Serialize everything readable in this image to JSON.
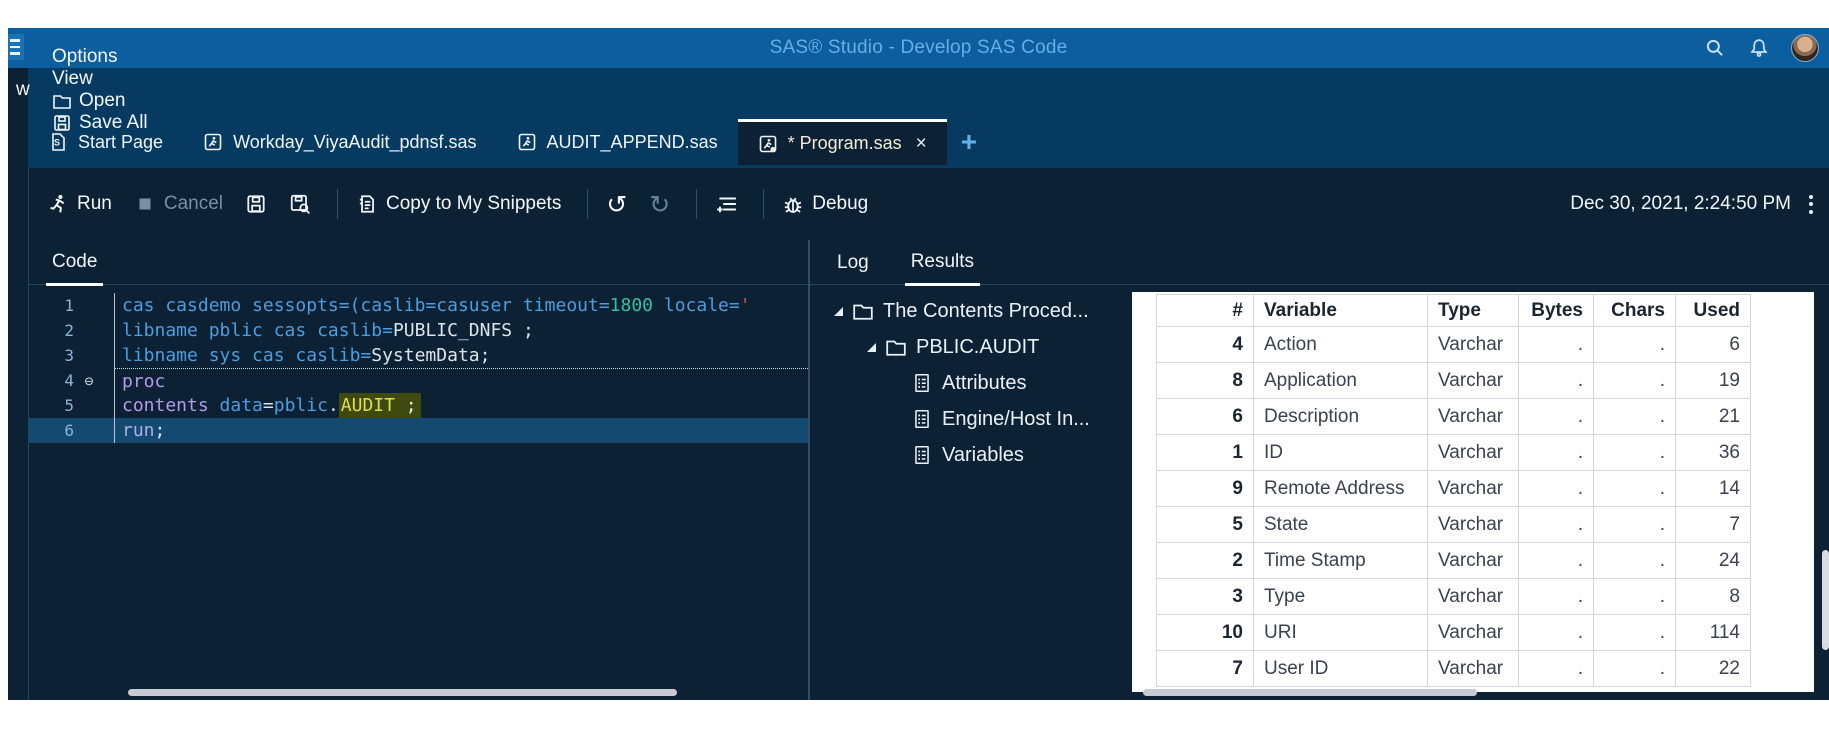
{
  "palette": {
    "title_bar_bg": "#0D5E9E",
    "title_text": "#66AEE6",
    "strip_bg": "#063A60",
    "content_bg": "#0C2134",
    "active_tab_border": "#FFFFFF",
    "selected_line_bg": "#154A70",
    "keyword_blue": "#4C9EE0",
    "number_teal": "#38BFA2",
    "proc_purple": "#B49AE8",
    "string_red": "#C05A50",
    "search_highlight_bg": "#3E4A0E",
    "search_highlight_text": "#E0DE54",
    "table_bg": "#FFFFFF",
    "add_tab_blue": "#5FB0EC"
  },
  "title_bar": {
    "title": "SAS® Studio - Develop SAS Code",
    "icons": [
      "hamburger-icon",
      "search-icon",
      "bell-icon",
      "avatar"
    ]
  },
  "menu_bar": {
    "partial_item": "w",
    "items": [
      {
        "label": "Options",
        "icon": null
      },
      {
        "label": "View",
        "icon": null
      },
      {
        "label": "Open",
        "icon": "folder-icon"
      },
      {
        "label": "Save All",
        "icon": "save-all-icon"
      }
    ]
  },
  "tab_strip": {
    "tabs": [
      {
        "label": "Start Page",
        "icon": "start-page-icon",
        "active": false,
        "close": null
      },
      {
        "label": "Workday_ViyaAudit_pdnsf.sas",
        "icon": "program-icon",
        "active": false,
        "close": null
      },
      {
        "label": "AUDIT_APPEND.sas",
        "icon": "program-icon",
        "active": false,
        "close": null
      },
      {
        "label": "* Program.sas",
        "icon": "program-modified-icon",
        "active": true,
        "close": "×"
      }
    ],
    "add_label": "+"
  },
  "toolbar": {
    "buttons": [
      {
        "type": "btn",
        "icon": "run-icon",
        "label": "Run",
        "enabled": true
      },
      {
        "type": "btn",
        "icon": "cancel-icon",
        "label": "Cancel",
        "enabled": false
      },
      {
        "type": "btn",
        "icon": "save-icon",
        "label": "",
        "enabled": true
      },
      {
        "type": "btn",
        "icon": "save-as-icon",
        "label": "",
        "enabled": true
      },
      {
        "type": "sep"
      },
      {
        "type": "btn",
        "icon": "copy-snippet-icon",
        "label": "Copy to My Snippets",
        "enabled": true
      },
      {
        "type": "sep"
      },
      {
        "type": "glyph",
        "icon": "undo-icon",
        "glyph": "↺",
        "enabled": true
      },
      {
        "type": "glyph",
        "icon": "redo-icon",
        "glyph": "↻",
        "enabled": false
      },
      {
        "type": "sep"
      },
      {
        "type": "btn",
        "icon": "format-code-icon",
        "label": "",
        "enabled": true
      },
      {
        "type": "sep"
      },
      {
        "type": "btn",
        "icon": "debug-bug-icon",
        "label": "Debug",
        "enabled": true
      }
    ],
    "timestamp": "Dec 30, 2021, 2:24:50 PM"
  },
  "code_pane": {
    "tab_label": "Code",
    "lines": [
      {
        "num": "1",
        "fold": false,
        "divider": false,
        "selected": false,
        "tokens": [
          {
            "t": "cas casdemo sessopts=(caslib=casuser timeout=",
            "c": "kw"
          },
          {
            "t": "1800",
            "c": "num"
          },
          {
            "t": " locale=",
            "c": "kw"
          },
          {
            "t": "'",
            "c": "str"
          }
        ]
      },
      {
        "num": "2",
        "fold": false,
        "divider": false,
        "selected": false,
        "tokens": [
          {
            "t": "libname pblic cas caslib=",
            "c": "kw"
          },
          {
            "t": "PUBLIC_DNFS ;",
            "c": "plain"
          }
        ]
      },
      {
        "num": "3",
        "fold": false,
        "divider": false,
        "selected": false,
        "tokens": [
          {
            "t": "libname sys cas caslib=",
            "c": "kw"
          },
          {
            "t": "SystemData;",
            "c": "plain"
          }
        ]
      },
      {
        "num": "4",
        "fold": true,
        "divider": true,
        "selected": false,
        "tokens": [
          {
            "t": "proc",
            "c": "proc"
          }
        ]
      },
      {
        "num": "5",
        "fold": false,
        "divider": false,
        "selected": false,
        "tokens": [
          {
            "t": "contents",
            "c": "proc"
          },
          {
            "t": " ",
            "c": "plain"
          },
          {
            "t": "data",
            "c": "kw"
          },
          {
            "t": "=",
            "c": "plain"
          },
          {
            "t": "pblic",
            "c": "kw"
          },
          {
            "t": ".",
            "c": "plain"
          },
          {
            "t": "AUDIT",
            "c": "hl-y"
          },
          {
            "t": " ;",
            "c": "hl-w"
          }
        ]
      },
      {
        "num": "6",
        "fold": false,
        "divider": false,
        "selected": true,
        "tokens": [
          {
            "t": "run",
            "c": "run"
          },
          {
            "t": ";",
            "c": "plain"
          }
        ]
      }
    ],
    "fold_glyph": "⊖"
  },
  "results_pane": {
    "tabs": [
      {
        "label": "Log",
        "active": false
      },
      {
        "label": "Results",
        "active": true
      }
    ],
    "tree": [
      {
        "label": "The Contents Proced...",
        "level": 1,
        "icon": "folder-icon",
        "expanded": true
      },
      {
        "label": "PBLIC.AUDIT",
        "level": 2,
        "icon": "folder-icon",
        "expanded": true
      },
      {
        "label": "Attributes",
        "level": 3,
        "icon": "doc-list-icon",
        "expanded": null
      },
      {
        "label": "Engine/Host In...",
        "level": 3,
        "icon": "doc-list-icon",
        "expanded": null
      },
      {
        "label": "Variables",
        "level": 3,
        "icon": "doc-list-icon",
        "expanded": null
      }
    ],
    "table": {
      "headers": [
        "#",
        "Variable",
        "Type",
        "Bytes",
        "Chars",
        "Used"
      ],
      "rows": [
        [
          "4",
          "Action",
          "Varchar",
          ".",
          ".",
          "6"
        ],
        [
          "8",
          "Application",
          "Varchar",
          ".",
          ".",
          "19"
        ],
        [
          "6",
          "Description",
          "Varchar",
          ".",
          ".",
          "21"
        ],
        [
          "1",
          "ID",
          "Varchar",
          ".",
          ".",
          "36"
        ],
        [
          "9",
          "Remote Address",
          "Varchar",
          ".",
          ".",
          "14"
        ],
        [
          "5",
          "State",
          "Varchar",
          ".",
          ".",
          "7"
        ],
        [
          "2",
          "Time Stamp",
          "Varchar",
          ".",
          ".",
          "24"
        ],
        [
          "3",
          "Type",
          "Varchar",
          ".",
          ".",
          "8"
        ],
        [
          "10",
          "URI",
          "Varchar",
          ".",
          ".",
          "114"
        ],
        [
          "7",
          "User ID",
          "Varchar",
          ".",
          ".",
          "22"
        ]
      ]
    }
  }
}
